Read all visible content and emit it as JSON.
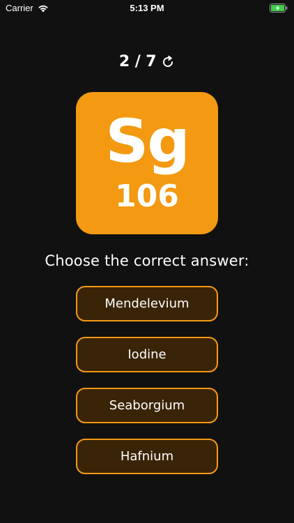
{
  "status_bar": {
    "carrier": "Carrier",
    "time": "5:13 PM",
    "wifi_icon": "wifi-icon",
    "battery_icon": "battery-charging-icon",
    "battery_color": "#3ccf4e"
  },
  "progress": {
    "current": "2",
    "separator": "/",
    "total": "7",
    "icon": "refresh-icon"
  },
  "element": {
    "symbol": "Sg",
    "atomic_number": "106",
    "tile_color": "#f39a12"
  },
  "prompt": "Choose the correct answer:",
  "answers": [
    {
      "label": "Mendelevium"
    },
    {
      "label": "Iodine"
    },
    {
      "label": "Seaborgium"
    },
    {
      "label": "Hafnium"
    }
  ],
  "colors": {
    "background": "#111111",
    "button_fill": "#3a2407",
    "button_border": "#f39a12"
  }
}
